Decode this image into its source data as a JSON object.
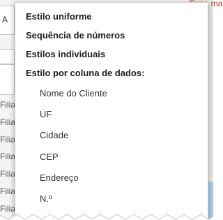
{
  "background": {
    "field_text": "A",
    "row_labels": [
      "Filial",
      "Filial",
      "Filial",
      "Filial",
      "Filial",
      "Filial",
      "Filial"
    ],
    "map_label": "Espa ma"
  },
  "menu": {
    "headers": [
      "Estilo uniforme",
      "Sequência de números",
      "Estilos individuais",
      "Estilo por coluna de dados:"
    ],
    "columns": [
      "Nome do Cliente",
      "UF",
      "Cidade",
      "CEP",
      "Endereço",
      "N.º"
    ]
  },
  "colors": {
    "menu_bg": "#ffffff",
    "header_text": "#212121",
    "item_text": "#333333",
    "map_water": "#a9d1e8"
  }
}
